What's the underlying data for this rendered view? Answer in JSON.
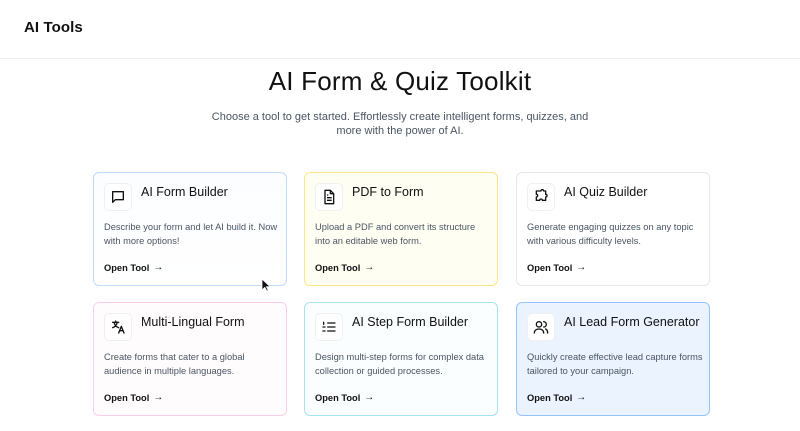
{
  "header": {
    "brand": "AI Tools"
  },
  "hero": {
    "title": "AI Form & Quiz Toolkit",
    "subtitle": "Choose a tool to get started. Effortlessly create intelligent forms, quizzes, and more with the power of AI."
  },
  "cards": [
    {
      "title": "AI Form Builder",
      "description": "Describe your form and let AI build it. Now with more options!",
      "link": "Open Tool",
      "icon": "chat-bubble-icon"
    },
    {
      "title": "PDF to Form",
      "description": "Upload a PDF and convert its structure into an editable web form.",
      "link": "Open Tool",
      "icon": "document-icon"
    },
    {
      "title": "AI Quiz Builder",
      "description": "Generate engaging quizzes on any topic with various difficulty levels.",
      "link": "Open Tool",
      "icon": "puzzle-icon"
    },
    {
      "title": "Multi-Lingual Form",
      "description": "Create forms that cater to a global audience in multiple languages.",
      "link": "Open Tool",
      "icon": "translate-icon"
    },
    {
      "title": "AI Step Form Builder",
      "description": "Design multi-step forms for complex data collection or guided processes.",
      "link": "Open Tool",
      "icon": "list-steps-icon"
    },
    {
      "title": "AI Lead Form Generator",
      "description": "Quickly create effective lead capture forms tailored to your campaign.",
      "link": "Open Tool",
      "icon": "users-icon"
    }
  ],
  "colors": {
    "accent_blue": "#93c5fd",
    "active_bg": "#eaf3ff",
    "text": "#111827",
    "muted": "#4b5563"
  }
}
